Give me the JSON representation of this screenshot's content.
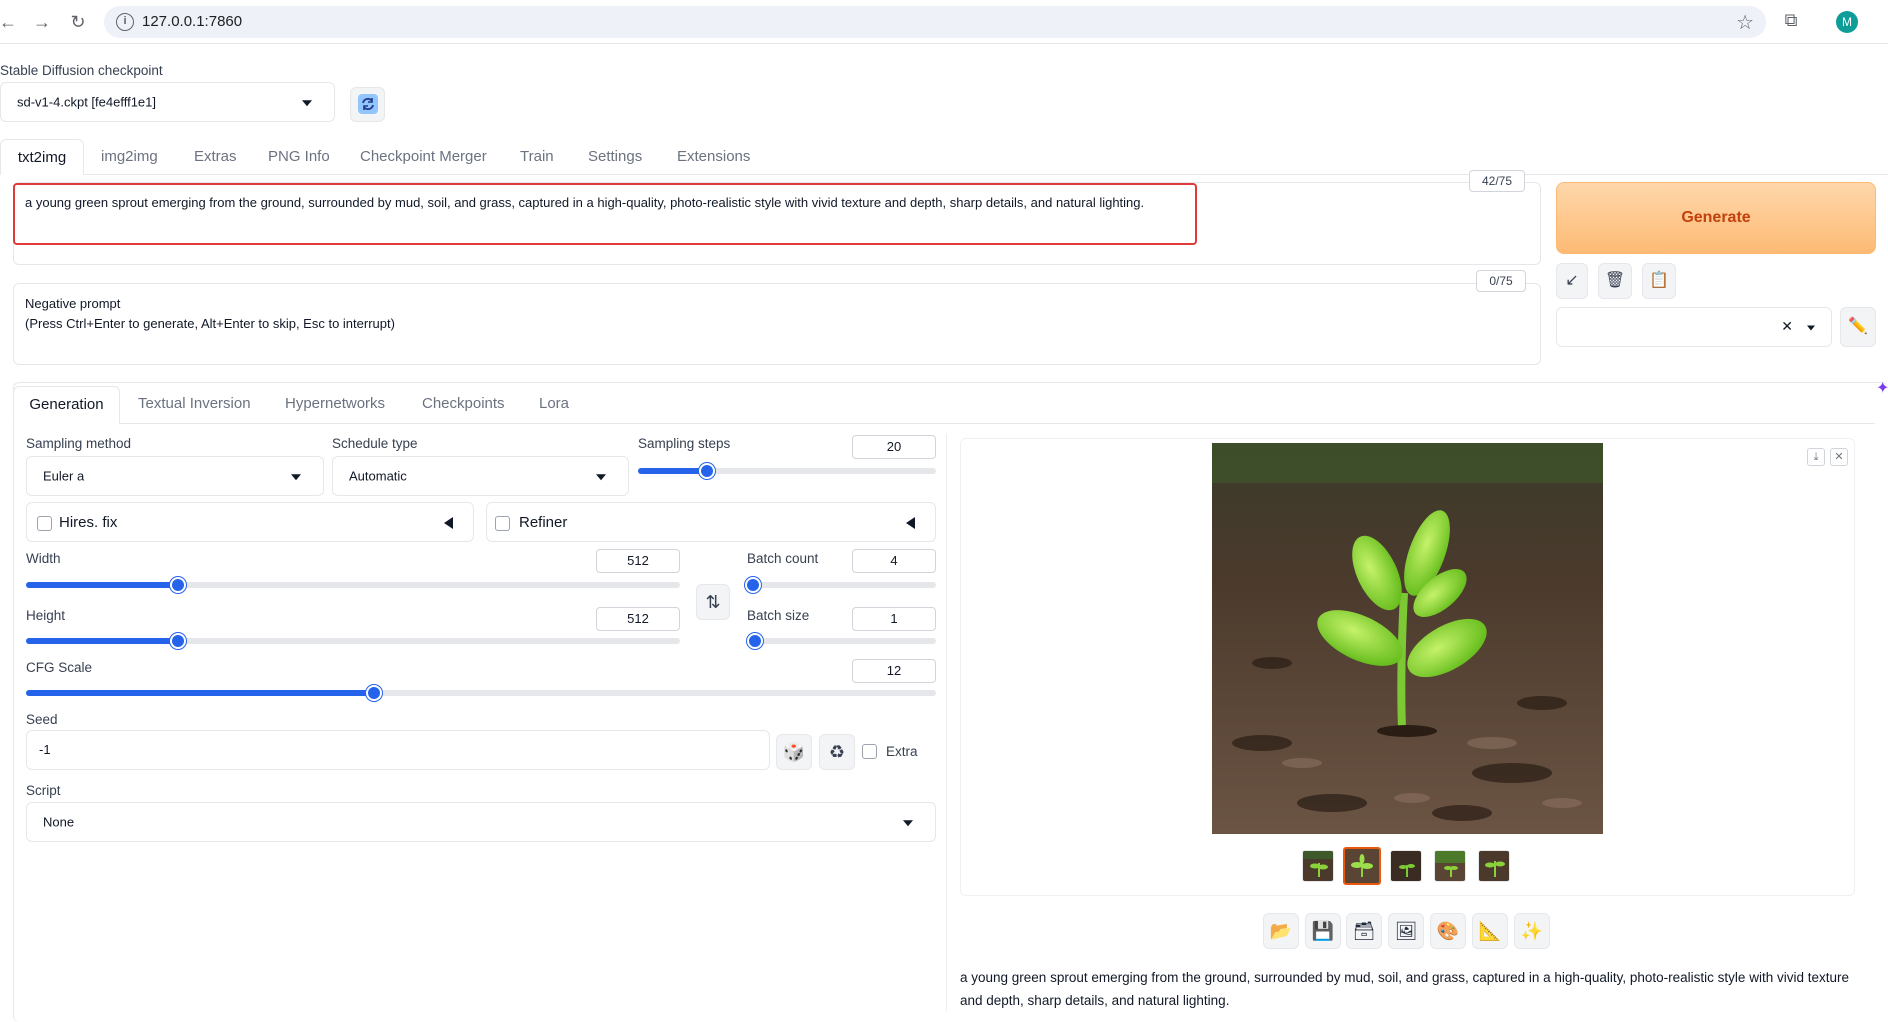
{
  "browser": {
    "url": "127.0.0.1:7860",
    "avatar_letter": "M"
  },
  "checkpoint": {
    "label": "Stable Diffusion checkpoint",
    "value": "sd-v1-4.ckpt [fe4efff1e1]"
  },
  "main_tabs": [
    {
      "label": "txt2img",
      "active": true
    },
    {
      "label": "img2img"
    },
    {
      "label": "Extras"
    },
    {
      "label": "PNG Info"
    },
    {
      "label": "Checkpoint Merger"
    },
    {
      "label": "Train"
    },
    {
      "label": "Settings"
    },
    {
      "label": "Extensions"
    }
  ],
  "prompt": {
    "text": "a young green sprout emerging from the ground, surrounded by mud, soil, and grass, captured in a high-quality, photo-realistic style with vivid texture and depth, sharp details, and natural lighting.",
    "counter": "42/75"
  },
  "negative_prompt": {
    "placeholder_line1": "Negative prompt",
    "placeholder_line2": "(Press Ctrl+Enter to generate, Alt+Enter to skip, Esc to interrupt)",
    "counter": "0/75"
  },
  "generate_label": "Generate",
  "sub_tabs": [
    {
      "label": "Generation",
      "active": true
    },
    {
      "label": "Textual Inversion"
    },
    {
      "label": "Hypernetworks"
    },
    {
      "label": "Checkpoints"
    },
    {
      "label": "Lora"
    }
  ],
  "generation": {
    "sampling_method_label": "Sampling method",
    "sampling_method_value": "Euler a",
    "schedule_type_label": "Schedule type",
    "schedule_type_value": "Automatic",
    "sampling_steps_label": "Sampling steps",
    "sampling_steps_value": "20",
    "hires_fix_label": "Hires. fix",
    "refiner_label": "Refiner",
    "width_label": "Width",
    "width_value": "512",
    "height_label": "Height",
    "height_value": "512",
    "batch_count_label": "Batch count",
    "batch_count_value": "4",
    "batch_size_label": "Batch size",
    "batch_size_value": "1",
    "cfg_label": "CFG Scale",
    "cfg_value": "12",
    "seed_label": "Seed",
    "seed_value": "-1",
    "extra_label": "Extra",
    "script_label": "Script",
    "script_value": "None"
  },
  "sliders": {
    "sampling_steps": 0.23,
    "width": 0.232,
    "height": 0.232,
    "batch_count": 0.03,
    "batch_size": 0.0,
    "cfg": 0.382
  },
  "output_caption": "a young green sprout emerging from the ground, surrounded by mud, soil, and grass, captured in a high-quality, photo-realistic style with vivid texture and depth, sharp details, and natural lighting.",
  "colors": {
    "accent": "#2563eb",
    "generate": "#fdba74",
    "highlight": "#e03a3a"
  }
}
